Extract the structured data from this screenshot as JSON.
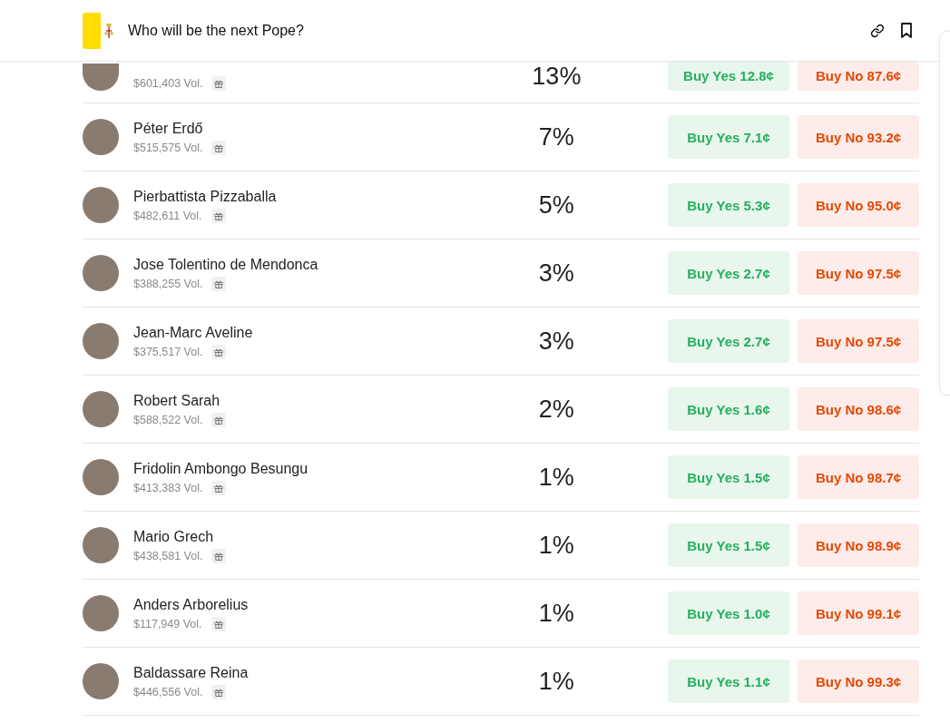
{
  "header": {
    "title": "Who will be the next Pope?"
  },
  "candidates": [
    {
      "volume": "$601,403 Vol.",
      "chance": "13%",
      "buy_yes": "Buy Yes 12.8¢",
      "buy_no": "Buy No 87.6¢"
    },
    {
      "name": "Péter Erdő",
      "volume": "$515,575 Vol.",
      "chance": "7%",
      "buy_yes": "Buy Yes 7.1¢",
      "buy_no": "Buy No 93.2¢"
    },
    {
      "name": "Pierbattista Pizzaballa",
      "volume": "$482,611 Vol.",
      "chance": "5%",
      "buy_yes": "Buy Yes 5.3¢",
      "buy_no": "Buy No 95.0¢"
    },
    {
      "name": "Jose Tolentino de Mendonca",
      "volume": "$388,255 Vol.",
      "chance": "3%",
      "buy_yes": "Buy Yes 2.7¢",
      "buy_no": "Buy No 97.5¢"
    },
    {
      "name": "Jean-Marc Aveline",
      "volume": "$375,517 Vol.",
      "chance": "3%",
      "buy_yes": "Buy Yes 2.7¢",
      "buy_no": "Buy No 97.5¢"
    },
    {
      "name": "Robert Sarah",
      "volume": "$588,522 Vol.",
      "chance": "2%",
      "buy_yes": "Buy Yes 1.6¢",
      "buy_no": "Buy No 98.6¢"
    },
    {
      "name": "Fridolin Ambongo Besungu",
      "volume": "$413,383 Vol.",
      "chance": "1%",
      "buy_yes": "Buy Yes 1.5¢",
      "buy_no": "Buy No 98.7¢"
    },
    {
      "name": "Mario Grech",
      "volume": "$438,581 Vol.",
      "chance": "1%",
      "buy_yes": "Buy Yes 1.5¢",
      "buy_no": "Buy No 98.9¢"
    },
    {
      "name": "Anders Arborelius",
      "volume": "$117,949 Vol.",
      "chance": "1%",
      "buy_yes": "Buy Yes 1.0¢",
      "buy_no": "Buy No 99.1¢"
    },
    {
      "name": "Baldassare Reina",
      "volume": "$446,556 Vol.",
      "chance": "1%",
      "buy_yes": "Buy Yes 1.1¢",
      "buy_no": "Buy No 99.3¢"
    }
  ]
}
